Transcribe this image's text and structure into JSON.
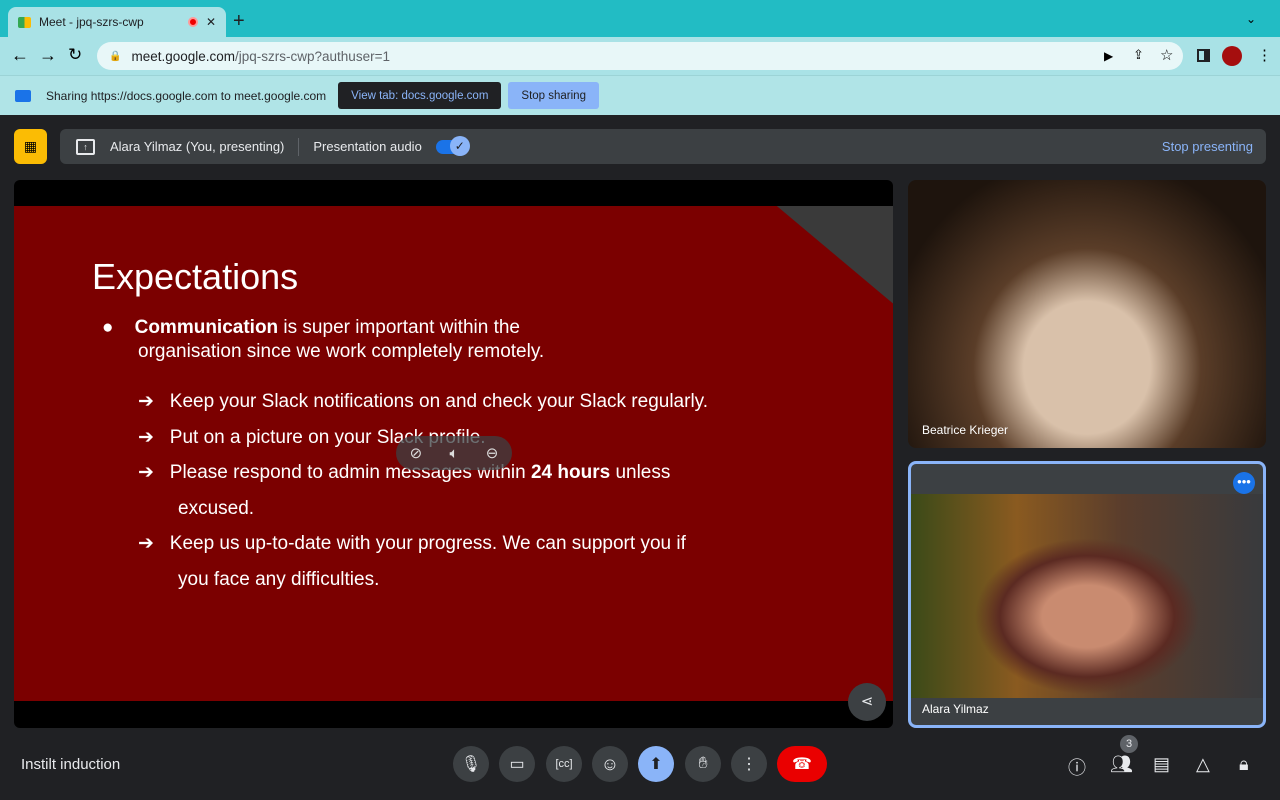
{
  "browser": {
    "tab_title": "Meet - jpq-szrs-cwp",
    "url_host": "meet.google.com",
    "url_path": "/jpq-szrs-cwp?authuser=1"
  },
  "sharing": {
    "text": "Sharing https://docs.google.com to meet.google.com",
    "view_tab": "View tab: docs.google.com",
    "stop": "Stop sharing"
  },
  "presenting": {
    "name": "Alara Yilmaz (You, presenting)",
    "audio_label": "Presentation audio",
    "audio_on": true,
    "stop": "Stop presenting"
  },
  "slide": {
    "title": "Expectations",
    "bullet_bold": "Communication",
    "bullet_rest": " is super important within the",
    "bullet_line2": "organisation since we work completely remotely.",
    "items": [
      "Keep your Slack notifications on and check your Slack regularly.",
      "Put on a picture on your Slack profile."
    ],
    "item3_a": "Please respond to admin messages within ",
    "item3_b": "24 hours",
    "item3_c": " unless",
    "item3_d": "excused.",
    "item4_a": "Keep us up-to-date with your progress. We can support you if",
    "item4_b": "you face any difficulties."
  },
  "participants": [
    {
      "name": "Beatrice Krieger"
    },
    {
      "name": "Alara Yilmaz"
    }
  ],
  "meeting_name": "Instilt induction",
  "people_count": "3",
  "colors": {
    "accent": "#8ab4f8",
    "end_call": "#ea0000",
    "slide_bg": "#7b0000"
  }
}
